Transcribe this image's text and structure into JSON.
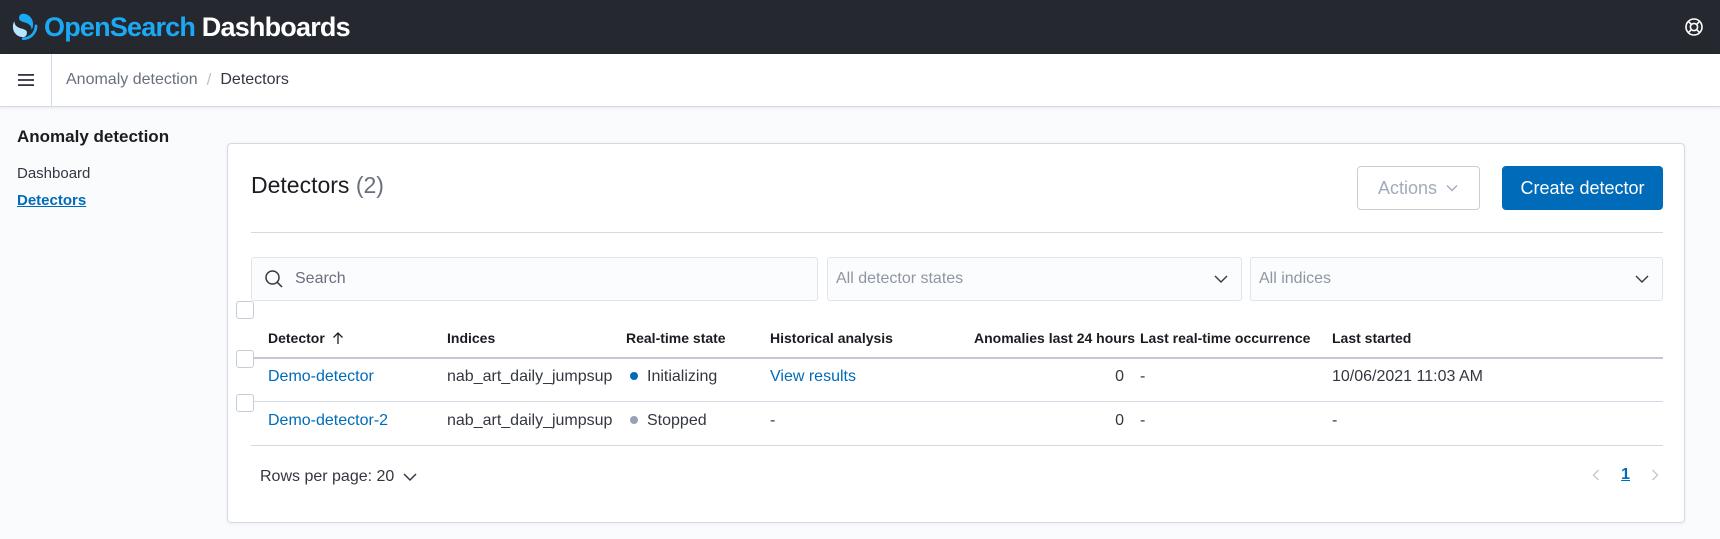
{
  "header": {
    "brand_open": "Open",
    "brand_search": "Search",
    "brand_dashboards": " Dashboards",
    "help_icon": "help-icon"
  },
  "breadcrumbs": {
    "items": [
      "Anomaly detection",
      "Detectors"
    ],
    "separator": "/"
  },
  "sidebar": {
    "title": "Anomaly detection",
    "items": [
      {
        "label": "Dashboard",
        "active": false
      },
      {
        "label": "Detectors",
        "active": true
      }
    ]
  },
  "main": {
    "title": "Detectors",
    "count": "(2)",
    "actions_label": "Actions",
    "create_label": "Create detector",
    "search_placeholder": "Search",
    "states_placeholder": "All detector states",
    "indices_placeholder": "All indices"
  },
  "table": {
    "columns": [
      "Detector",
      "Indices",
      "Real-time state",
      "Historical analysis",
      "Anomalies last 24 hours",
      "Last real-time occurrence",
      "Last started"
    ],
    "rows": [
      {
        "detector": "Demo-detector",
        "indices": "nab_art_daily_jumpsup",
        "state": "Initializing",
        "state_color": "#006bb8",
        "historical": "View results",
        "anomalies": "0",
        "last_occurrence": "-",
        "last_started": "10/06/2021 11:03 AM"
      },
      {
        "detector": "Demo-detector-2",
        "indices": "nab_art_daily_jumpsup",
        "state": "Stopped",
        "state_color": "#98a2b3",
        "historical": "-",
        "anomalies": "0",
        "last_occurrence": "-",
        "last_started": "-"
      }
    ]
  },
  "footer": {
    "rows_per_page": "Rows per page: 20",
    "current_page": "1"
  },
  "colors": {
    "header_bg": "#25282f",
    "brand_blue": "#1ba9f5",
    "primary": "#006bb8"
  }
}
